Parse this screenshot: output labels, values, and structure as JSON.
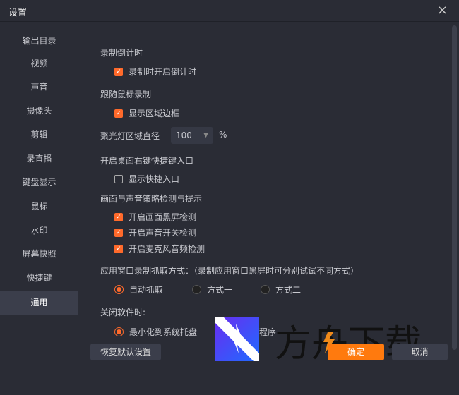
{
  "window": {
    "title": "设置",
    "close_icon": "×"
  },
  "sidebar": {
    "items": [
      "输出目录",
      "视频",
      "声音",
      "摄像头",
      "剪辑",
      "录直播",
      "键盘显示",
      "鼠标",
      "水印",
      "屏幕快照",
      "快捷键",
      "通用"
    ],
    "active": "通用"
  },
  "countdown": {
    "title": "录制倒计时",
    "option": "录制时开启倒计时",
    "checked": true
  },
  "follow_mouse": {
    "title": "跟随鼠标录制",
    "option": "显示区域边框",
    "checked": true
  },
  "spotlight": {
    "label": "聚光灯区域直径",
    "value": "100",
    "unit": "%"
  },
  "desktop_menu": {
    "title": "开启桌面右键快捷键入口",
    "option": "显示快捷入口",
    "checked": false
  },
  "detection": {
    "title": "画面与声音策略检测与提示",
    "options": [
      {
        "label": "开启画面黑屏检测",
        "checked": true
      },
      {
        "label": "开启声音开关检测",
        "checked": true
      },
      {
        "label": "开启麦克风音频检测",
        "checked": true
      }
    ]
  },
  "capture": {
    "title": "应用窗口录制抓取方式：（录制应用窗口黑屏时可分别试试不同方式）",
    "options": [
      "自动抓取",
      "方式一",
      "方式二"
    ],
    "selected": "自动抓取"
  },
  "close_behavior": {
    "title": "关闭软件时:",
    "options": [
      "最小化到系统托盘",
      "程序"
    ],
    "selected": "最小化到系统托盘"
  },
  "buttons": {
    "reset": "恢复默认设置",
    "ok": "确定",
    "cancel": "取消"
  },
  "watermark": {
    "text": "方舟下载"
  },
  "colors": {
    "accent": "#ff6a2b",
    "ok_button": "#ff7a0e"
  }
}
